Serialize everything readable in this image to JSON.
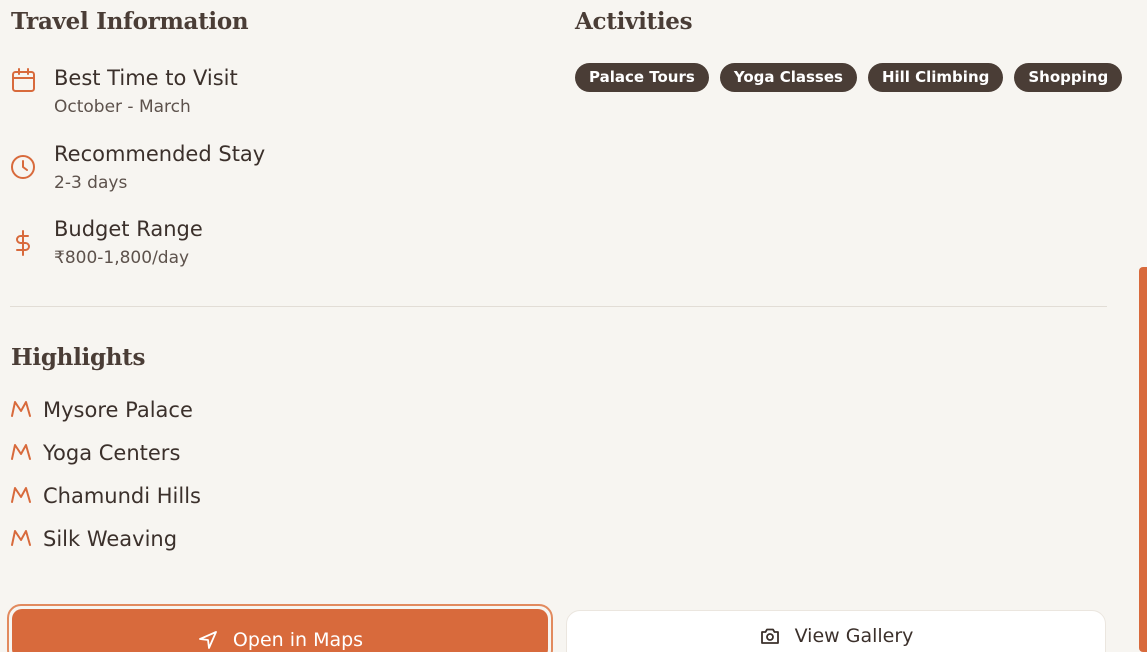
{
  "travel_info": {
    "title": "Travel Information",
    "items": [
      {
        "icon": "calendar-icon",
        "label": "Best Time to Visit",
        "value": "October - March"
      },
      {
        "icon": "clock-icon",
        "label": "Recommended Stay",
        "value": "2-3 days"
      },
      {
        "icon": "dollar-icon",
        "label": "Budget Range",
        "value": "₹800-1,800/day"
      }
    ]
  },
  "activities": {
    "title": "Activities",
    "tags": [
      "Palace Tours",
      "Yoga Classes",
      "Hill Climbing",
      "Shopping"
    ]
  },
  "highlights": {
    "title": "Highlights",
    "icon": "mountain-icon",
    "items": [
      "Mysore Palace",
      "Yoga Centers",
      "Chamundi Hills",
      "Silk Weaving"
    ]
  },
  "actions": {
    "maps_label": "Open in Maps",
    "maps_icon": "navigation-icon",
    "gallery_label": "View Gallery",
    "gallery_icon": "camera-icon"
  },
  "colors": {
    "accent": "#d86a3c",
    "chip_bg": "#4a3d36",
    "background": "#f7f5f1"
  }
}
